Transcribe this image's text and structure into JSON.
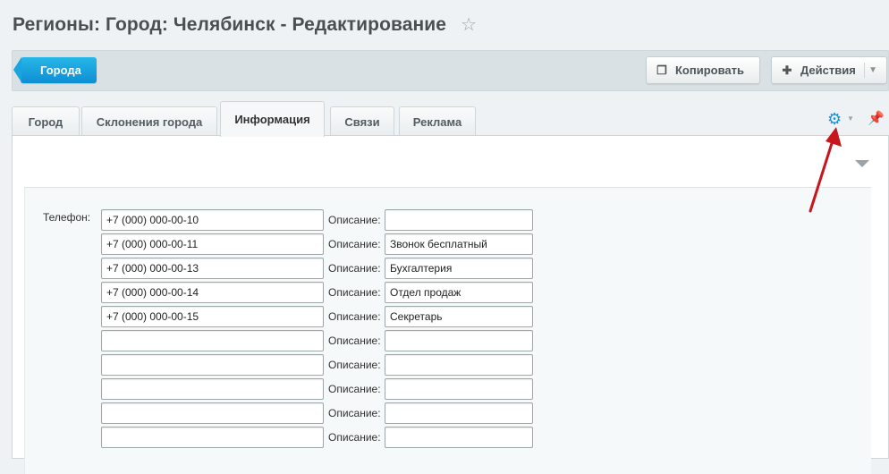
{
  "header": {
    "title": "Регионы: Город: Челябинск - Редактирование"
  },
  "toolbar": {
    "back_label": "Города",
    "copy_label": "Копировать",
    "actions_label": "Действия"
  },
  "tabs": [
    {
      "label": "Город"
    },
    {
      "label": "Склонения города"
    },
    {
      "label": "Информация"
    },
    {
      "label": "Связи"
    },
    {
      "label": "Реклама"
    }
  ],
  "form": {
    "phone_label": "Телефон:",
    "desc_label": "Описание:",
    "rows": [
      {
        "phone": "+7 (000) 000-00-10",
        "desc": ""
      },
      {
        "phone": "+7 (000) 000-00-11",
        "desc": "Звонок бесплатный"
      },
      {
        "phone": "+7 (000) 000-00-13",
        "desc": "Бухгалтерия"
      },
      {
        "phone": "+7 (000) 000-00-14",
        "desc": "Отдел продаж"
      },
      {
        "phone": "+7 (000) 000-00-15",
        "desc": "Секретарь"
      },
      {
        "phone": "",
        "desc": ""
      },
      {
        "phone": "",
        "desc": ""
      },
      {
        "phone": "",
        "desc": ""
      },
      {
        "phone": "",
        "desc": ""
      },
      {
        "phone": "",
        "desc": ""
      }
    ]
  },
  "colors": {
    "accent": "#1e8fd8",
    "annotation": "#c8161d"
  }
}
